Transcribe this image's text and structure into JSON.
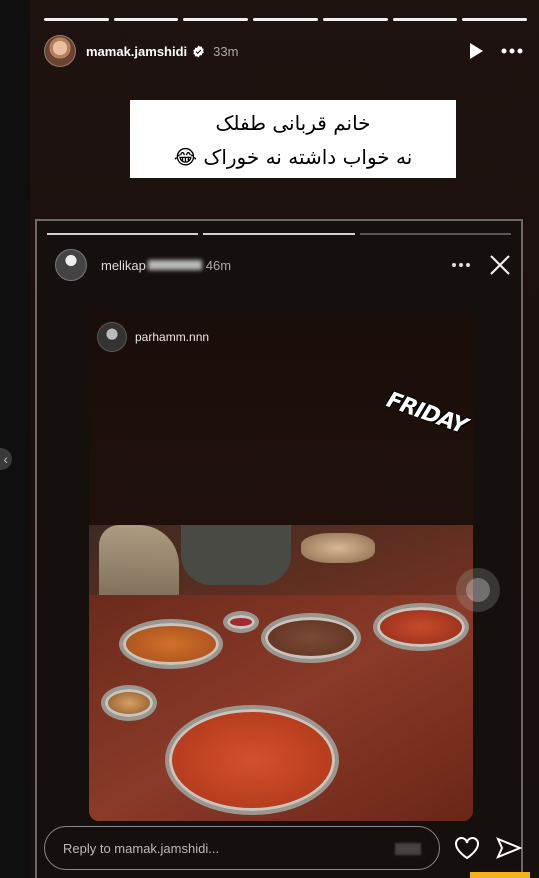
{
  "story": {
    "progress_segments": 7,
    "progress_active": 7,
    "username": "mamak.jamshidi",
    "time": "33m",
    "caption_line1": "خانم قربانی طفلک",
    "caption_line2": "نه خواب داشته نه خوراک 😂",
    "reply_placeholder": "Reply to mamak.jamshidi..."
  },
  "inner_story": {
    "username": "melikap",
    "time": "46m"
  },
  "repost": {
    "username": "parhamm.nnn",
    "sticker": "FRIDAY"
  },
  "icons": {
    "verified": "verified-badge-icon",
    "play": "play-icon",
    "more": "more-options-icon",
    "close": "close-icon",
    "heart": "heart-icon",
    "send": "send-icon",
    "chevron": "chevron-left-icon"
  },
  "colors": {
    "background": "#0f0f0f",
    "story_bg": "#1a100d",
    "accent_yellow": "#f2b21a"
  }
}
